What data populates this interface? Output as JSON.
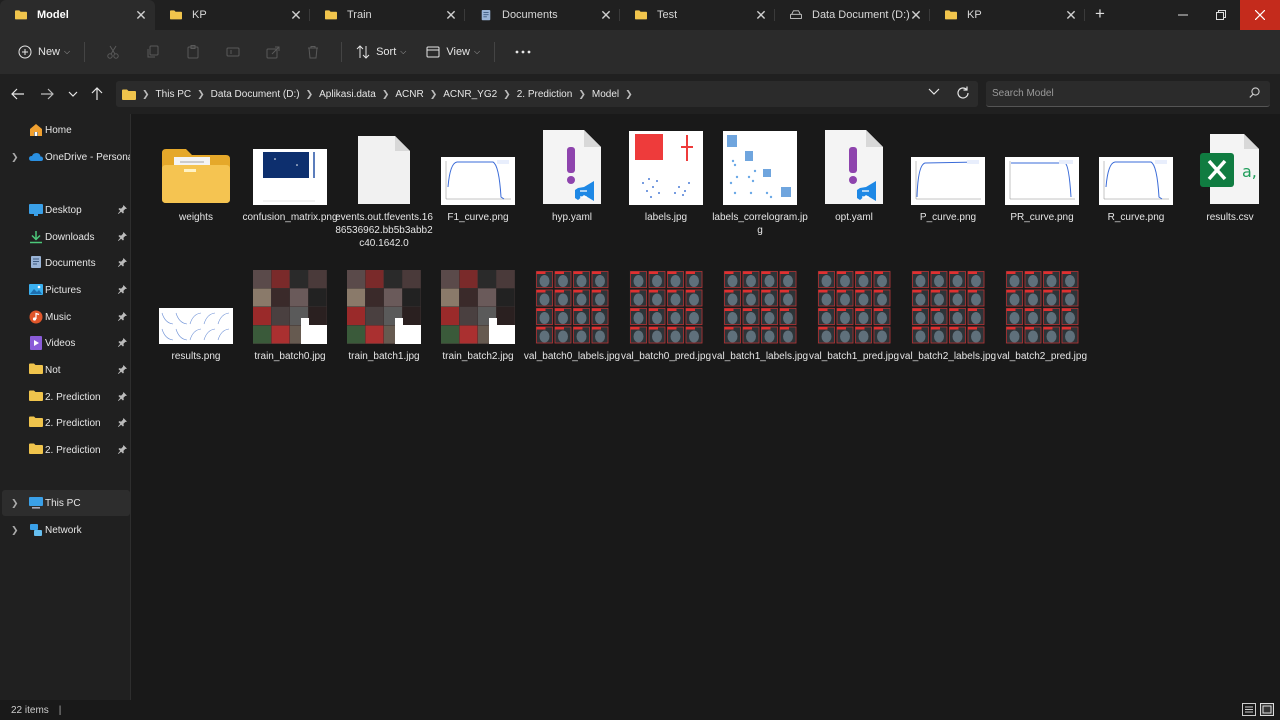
{
  "tabs": [
    {
      "label": "Model",
      "icon": "folder-icon",
      "active": true
    },
    {
      "label": "KP",
      "icon": "folder-icon"
    },
    {
      "label": "Train",
      "icon": "folder-icon"
    },
    {
      "label": "Documents",
      "icon": "documents-icon"
    },
    {
      "label": "Test",
      "icon": "folder-icon"
    },
    {
      "label": "Data Document (D:)",
      "icon": "drive-icon"
    },
    {
      "label": "KP",
      "icon": "folder-icon"
    }
  ],
  "toolbar": {
    "new_label": "New",
    "sort_label": "Sort",
    "view_label": "View"
  },
  "breadcrumb": [
    "This PC",
    "Data Document (D:)",
    "Aplikasi.data",
    "ACNR",
    "ACNR_YG2",
    "2. Prediction",
    "Model"
  ],
  "search": {
    "placeholder": "Search Model"
  },
  "sidebar": {
    "items": [
      {
        "label": "Home",
        "icon": "home-icon"
      },
      {
        "label": "OneDrive - Personal",
        "icon": "onedrive-icon"
      },
      {
        "label": "Desktop",
        "icon": "desktop-icon",
        "pinned": true
      },
      {
        "label": "Downloads",
        "icon": "downloads-icon",
        "pinned": true
      },
      {
        "label": "Documents",
        "icon": "documents-icon",
        "pinned": true
      },
      {
        "label": "Pictures",
        "icon": "pictures-icon",
        "pinned": true
      },
      {
        "label": "Music",
        "icon": "music-icon",
        "pinned": true
      },
      {
        "label": "Videos",
        "icon": "videos-icon",
        "pinned": true
      },
      {
        "label": "Not",
        "icon": "folder-icon",
        "pinned": true
      },
      {
        "label": "2. Prediction",
        "icon": "folder-icon",
        "pinned": true
      },
      {
        "label": "2. Prediction",
        "icon": "folder-icon",
        "pinned": true
      },
      {
        "label": "2. Prediction",
        "icon": "folder-icon",
        "pinned": true
      },
      {
        "label": "This PC",
        "icon": "this-pc-icon",
        "selected": true
      },
      {
        "label": "Network",
        "icon": "network-icon"
      }
    ]
  },
  "files": [
    {
      "name": "weights",
      "kind": "folder"
    },
    {
      "name": "confusion_matrix.png",
      "kind": "matrix"
    },
    {
      "name": "events.out.tfevents.1686536962.bb5b3abb2c40.1642.0",
      "kind": "blank"
    },
    {
      "name": "F1_curve.png",
      "kind": "curve-down"
    },
    {
      "name": "hyp.yaml",
      "kind": "yaml"
    },
    {
      "name": "labels.jpg",
      "kind": "labels"
    },
    {
      "name": "labels_correlogram.jpg",
      "kind": "correlogram"
    },
    {
      "name": "opt.yaml",
      "kind": "yaml"
    },
    {
      "name": "P_curve.png",
      "kind": "curve-up"
    },
    {
      "name": "PR_curve.png",
      "kind": "curve-flat"
    },
    {
      "name": "R_curve.png",
      "kind": "curve-down"
    },
    {
      "name": "results.csv",
      "kind": "excel"
    },
    {
      "name": "results.png",
      "kind": "results"
    },
    {
      "name": "train_batch0.jpg",
      "kind": "batch"
    },
    {
      "name": "train_batch1.jpg",
      "kind": "batch"
    },
    {
      "name": "train_batch2.jpg",
      "kind": "batch"
    },
    {
      "name": "val_batch0_labels.jpg",
      "kind": "val"
    },
    {
      "name": "val_batch0_pred.jpg",
      "kind": "val"
    },
    {
      "name": "val_batch1_labels.jpg",
      "kind": "val"
    },
    {
      "name": "val_batch1_pred.jpg",
      "kind": "val"
    },
    {
      "name": "val_batch2_labels.jpg",
      "kind": "val"
    },
    {
      "name": "val_batch2_pred.jpg",
      "kind": "val"
    }
  ],
  "status": {
    "items": "22 items"
  },
  "colors": {
    "folder": "#f0c44c",
    "accent": "#4cc2ff",
    "close": "#c42b1c",
    "excel": "#107c41",
    "yaml": "#8e44ad",
    "vscode": "#1e88e5"
  }
}
